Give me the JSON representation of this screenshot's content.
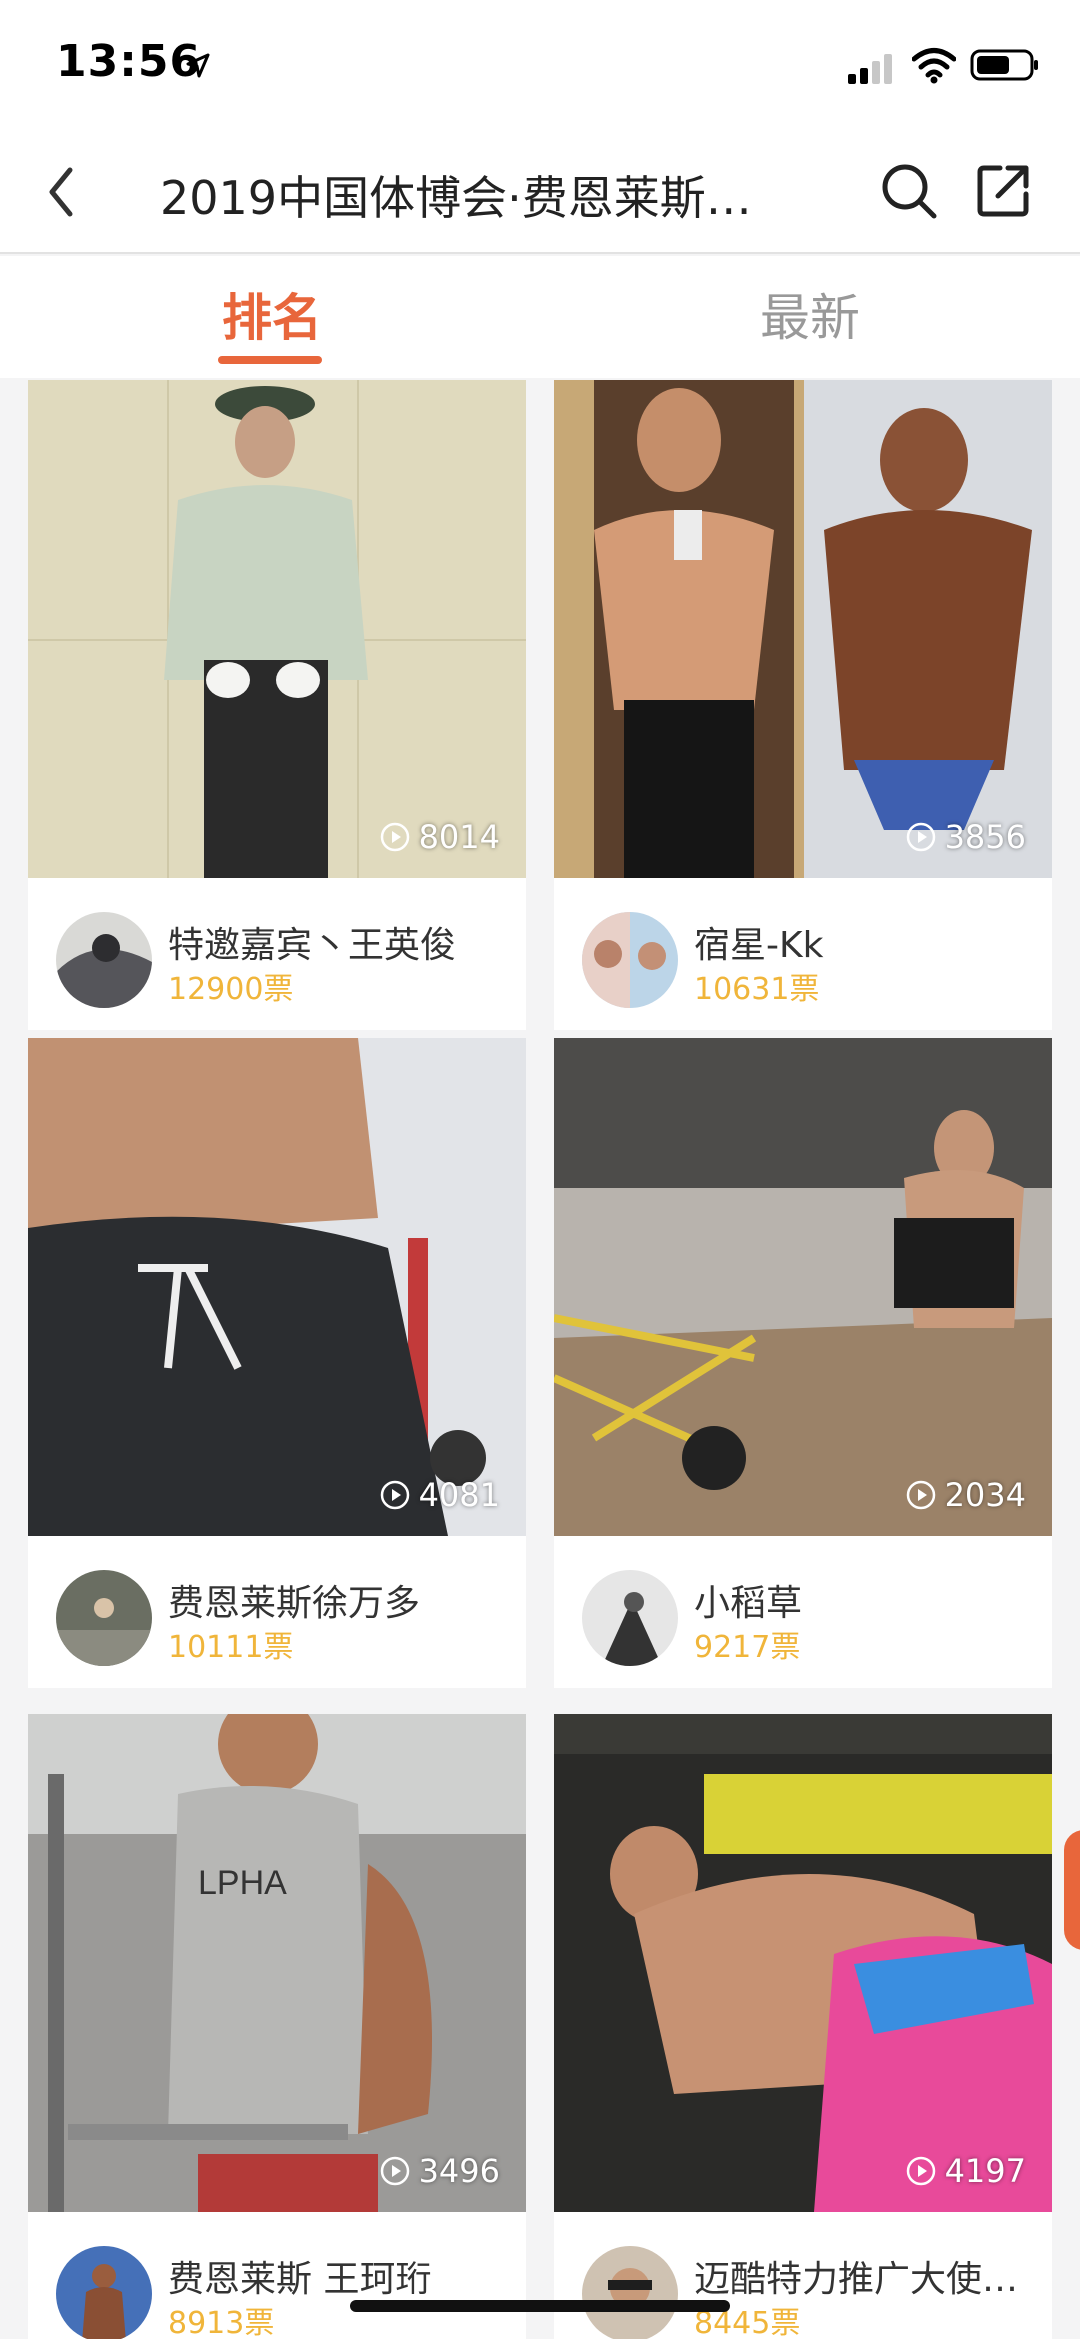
{
  "status_bar": {
    "time": "13:56"
  },
  "nav": {
    "title": "2019中国体博会·费恩莱斯…"
  },
  "tabs": [
    {
      "label": "排名",
      "active": true
    },
    {
      "label": "最新",
      "active": false
    }
  ],
  "colors": {
    "accent": "#e8663b",
    "votes": "#f0b53a"
  },
  "icons": [
    "location-arrow-icon",
    "signal-icon",
    "wifi-icon",
    "battery-icon",
    "back-icon",
    "search-icon",
    "share-icon",
    "play-icon"
  ],
  "cards": [
    {
      "plays": "8014",
      "name": "特邀嘉宾丶王英俊",
      "votes": "12900票"
    },
    {
      "plays": "3856",
      "name": "宿星-Kk",
      "votes": "10631票"
    },
    {
      "plays": "4081",
      "name": "费恩莱斯徐万多",
      "votes": "10111票"
    },
    {
      "plays": "2034",
      "name": "小稻草",
      "votes": "9217票"
    },
    {
      "plays": "3496",
      "name": "费恩莱斯 王珂珩",
      "votes": "8913票"
    },
    {
      "plays": "4197",
      "name": "迈酷特力推广大使…",
      "votes": "8445票"
    }
  ]
}
